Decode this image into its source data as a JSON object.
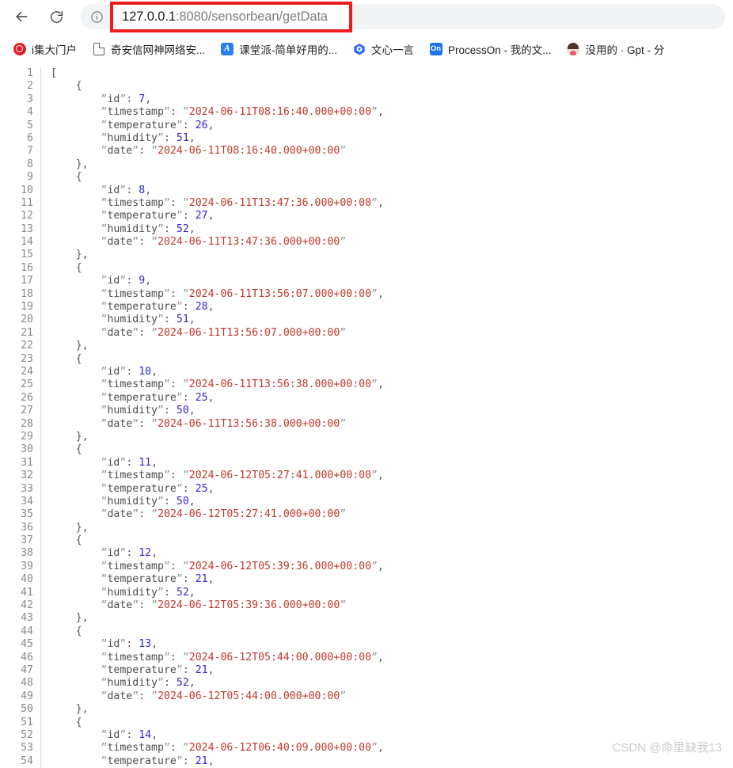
{
  "browser": {
    "back_icon": "back-arrow-icon",
    "reload_icon": "reload-icon",
    "site_info_icon": "info-circle-icon",
    "url": {
      "host": "127.0.0.1",
      "path": ":8080/sensorbean/getData",
      "full": "127.0.0.1:8080/sensorbean/getData",
      "highlight_color": "#ee1c1c"
    }
  },
  "bookmarks": [
    {
      "label": "i集大门户",
      "icon": "jida-portal-icon"
    },
    {
      "label": "奇安信网神网络安...",
      "icon": "document-icon"
    },
    {
      "label": "课堂派-简单好用的...",
      "icon": "ketangpai-icon",
      "icon_text": "A"
    },
    {
      "label": "文心一言",
      "icon": "wenxinyiyan-icon"
    },
    {
      "label": "ProcessOn - 我的文...",
      "icon": "processon-icon",
      "icon_text": "On"
    },
    {
      "label": "没用的 · Gpt - 分",
      "icon": "avatar-icon"
    }
  ],
  "watermark": "CSDN @命里缺我13",
  "json_response": {
    "records": [
      {
        "id": 7,
        "timestamp": "2024-06-11T08:16:40.000+00:00",
        "temperature": 26,
        "humidity": 51,
        "date": "2024-06-11T08:16:40.000+00:00"
      },
      {
        "id": 8,
        "timestamp": "2024-06-11T13:47:36.000+00:00",
        "temperature": 27,
        "humidity": 52,
        "date": "2024-06-11T13:47:36.000+00:00"
      },
      {
        "id": 9,
        "timestamp": "2024-06-11T13:56:07.000+00:00",
        "temperature": 28,
        "humidity": 51,
        "date": "2024-06-11T13:56:07.000+00:00"
      },
      {
        "id": 10,
        "timestamp": "2024-06-11T13:56:38.000+00:00",
        "temperature": 25,
        "humidity": 50,
        "date": "2024-06-11T13:56:38.000+00:00"
      },
      {
        "id": 11,
        "timestamp": "2024-06-12T05:27:41.000+00:00",
        "temperature": 25,
        "humidity": 50,
        "date": "2024-06-12T05:27:41.000+00:00"
      },
      {
        "id": 12,
        "timestamp": "2024-06-12T05:39:36.000+00:00",
        "temperature": 21,
        "humidity": 52,
        "date": "2024-06-12T05:39:36.000+00:00"
      },
      {
        "id": 13,
        "timestamp": "2024-06-12T05:44:00.000+00:00",
        "temperature": 21,
        "humidity": 52,
        "date": "2024-06-12T05:44:00.000+00:00"
      },
      {
        "id": 14,
        "timestamp": "2024-06-12T06:40:09.000+00:00",
        "temperature": null,
        "humidity": null,
        "date": null
      }
    ],
    "key_order": [
      "id",
      "timestamp",
      "temperature",
      "humidity",
      "date"
    ],
    "first_line": "[",
    "total_lines_visible": 54,
    "colors": {
      "number": "#2f27d6",
      "string": "#c0392b",
      "key": "#4d4d4d",
      "punctuation": "#555555",
      "line_number": "#8a8a8a"
    }
  }
}
